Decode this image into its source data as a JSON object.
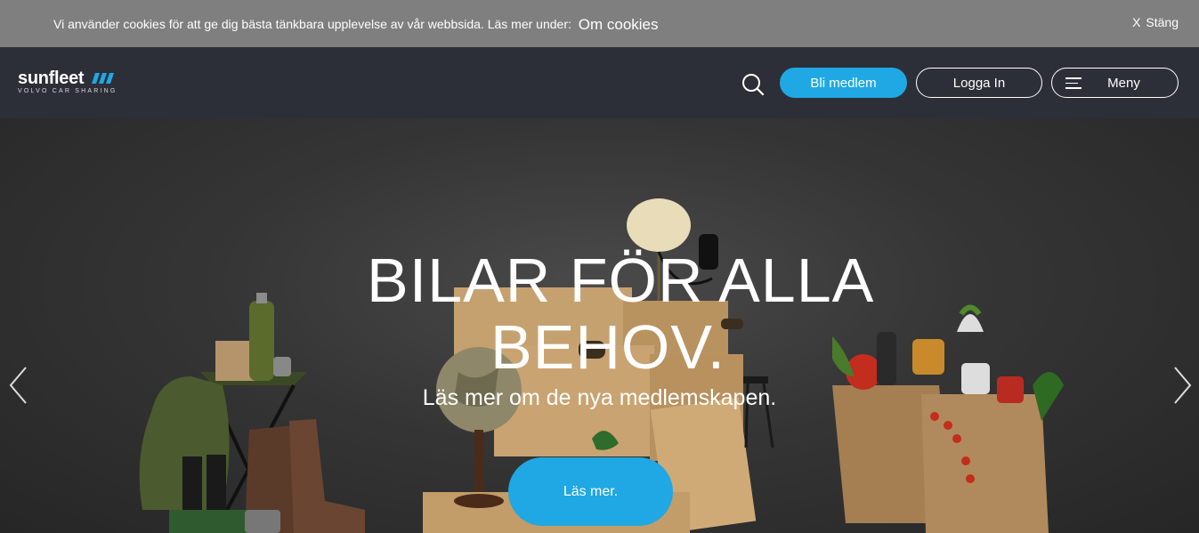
{
  "cookie": {
    "text": "Vi använder cookies för att ge dig bästa tänkbara upplevelse av vår webbsida. Läs mer under:",
    "link": "Om cookies",
    "close_x": "X",
    "close_label": "Stäng"
  },
  "header": {
    "logo_word": "sunfleet",
    "logo_sub": "VOLVO CAR SHARING",
    "member_button": "Bli medlem",
    "login_button": "Logga In",
    "menu_button": "Meny"
  },
  "hero": {
    "title_line1": "BILAR FÖR ALLA",
    "title_line2": "BEHOV.",
    "subtitle": "Läs mer om de nya medlemskapen.",
    "cta": "Läs mer."
  },
  "colors": {
    "accent": "#1fa8e3",
    "header_bg": "#2c2f38",
    "cookie_bg": "#7f7f7f"
  }
}
